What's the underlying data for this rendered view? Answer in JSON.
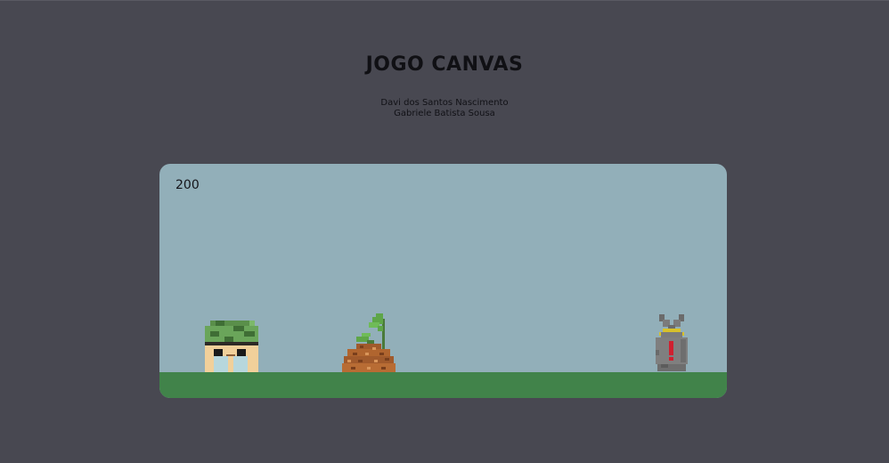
{
  "page": {
    "title": "JOGO CANVAS",
    "authors": [
      "Davi dos Santos Nascimento",
      "Gabriele Batista Sousa"
    ]
  },
  "game": {
    "score": "200",
    "colors": {
      "background": "#484851",
      "sky": "#92afb9",
      "ground": "#41834a"
    },
    "sprites": [
      {
        "name": "player-soldier",
        "icon": "soldier-helmet-icon"
      },
      {
        "name": "obstacle-dirt-mound-sprout",
        "icon": "dirt-sprout-icon"
      },
      {
        "name": "enemy-gray-bag",
        "icon": "gray-bag-icon"
      }
    ]
  }
}
